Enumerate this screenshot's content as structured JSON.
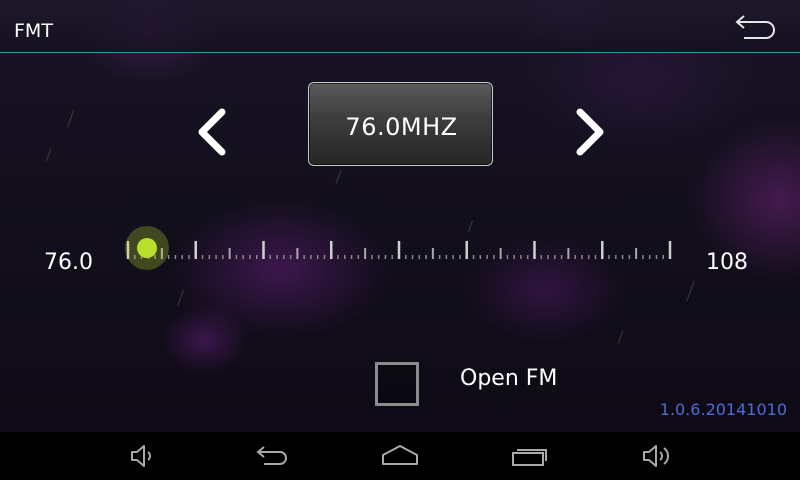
{
  "header": {
    "title": "FMT",
    "back_icon": "back-arrow-icon"
  },
  "tuner": {
    "frequency_display": "76.0MHZ",
    "prev_icon": "chevron-left-icon",
    "next_icon": "chevron-right-icon",
    "range_min_label": "76.0",
    "range_max_label": "108",
    "slider_range": [
      76.0,
      108.0
    ],
    "slider_value": 76.0
  },
  "open_fm": {
    "label": "Open FM",
    "checked": false
  },
  "version": "1.0.6.20141010",
  "nav_bar": {
    "icons": [
      "volume-down-icon",
      "back-icon",
      "home-icon",
      "recent-apps-icon",
      "volume-up-icon"
    ]
  },
  "colors": {
    "accent_line": "#3a8fb0",
    "slider_thumb": "#b6e02a",
    "version_text": "#4e6cd6"
  }
}
